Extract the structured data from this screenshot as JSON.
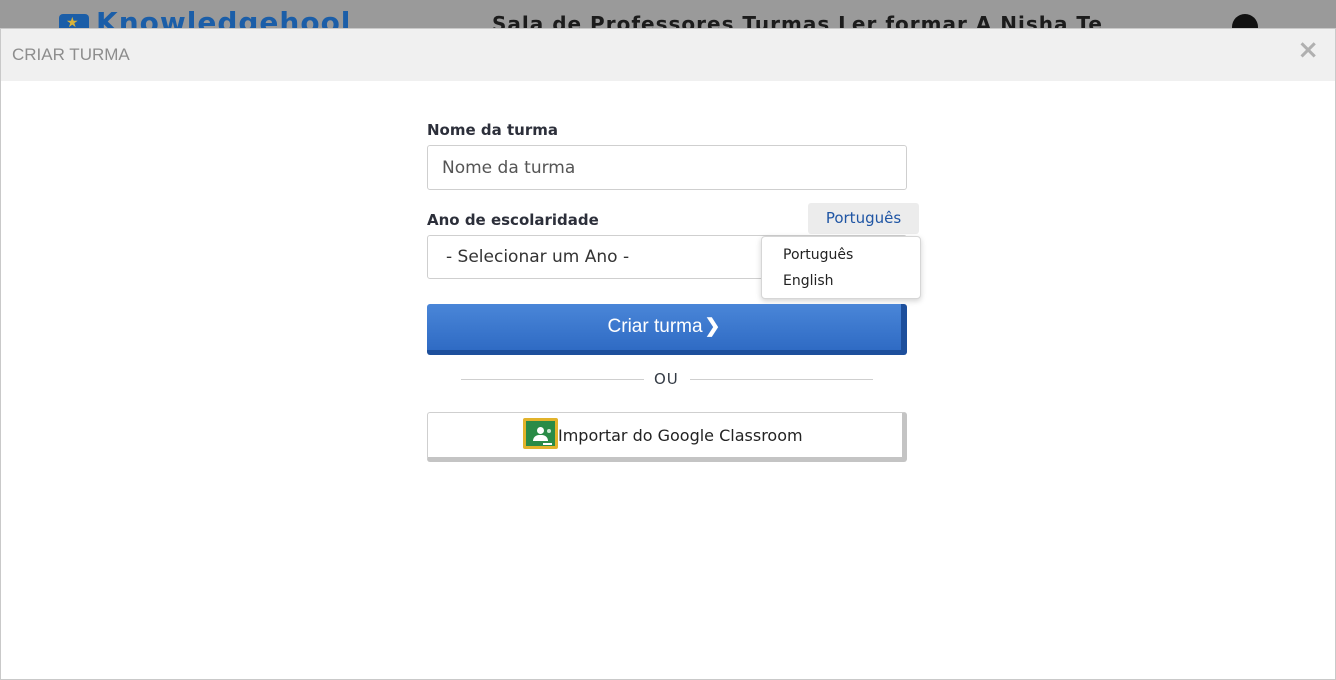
{
  "background": {
    "logo_text": "Knowledgehool",
    "nav_text": "Sala de Professores   Turmas   Ler formar   A  Nisha Te"
  },
  "modal": {
    "title": "CRIAR TURMA",
    "close_symbol": "×"
  },
  "form": {
    "class_name_label": "Nome da turma",
    "class_name_placeholder": "Nome da turma",
    "class_name_value": "",
    "grade_label": "Ano de escolaridade",
    "grade_selected": "- Selecionar um Ano -",
    "create_button": "Criar turma",
    "create_chevron": "❯",
    "divider_text": "OU",
    "google_button": "Importar do Google Classroom"
  },
  "language": {
    "current": "Português",
    "options": [
      "Português",
      "English"
    ]
  },
  "colors": {
    "primary": "#3a78cf",
    "link": "#1f55a4",
    "google_green": "#2a8b47",
    "google_yellow": "#e2b32b"
  }
}
